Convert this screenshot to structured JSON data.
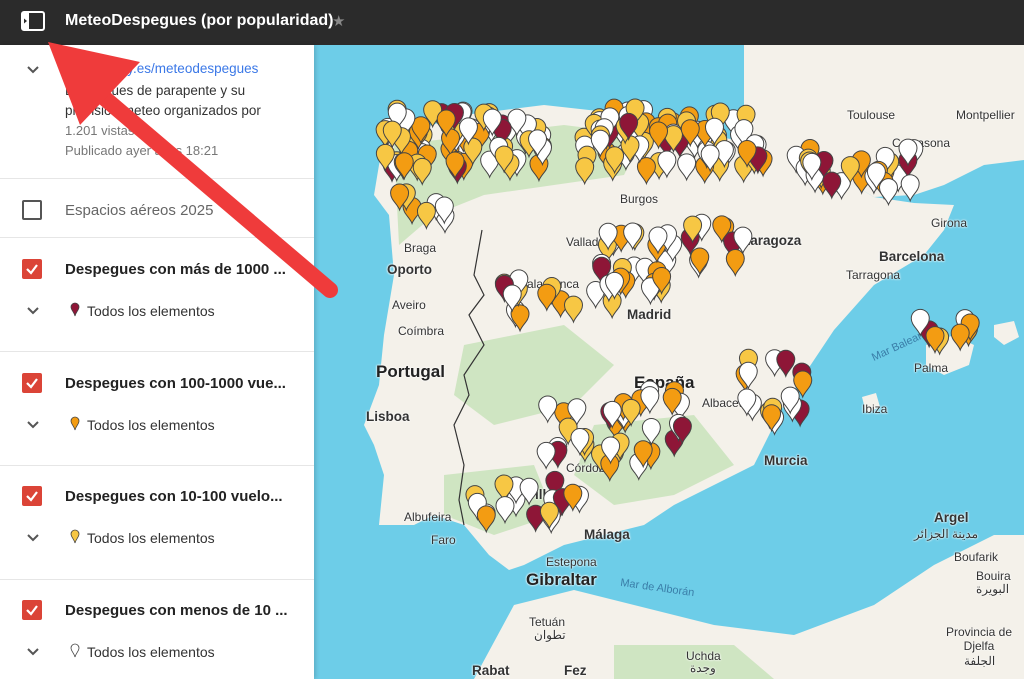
{
  "header": {
    "title": "MeteoDespegues (por popularidad)"
  },
  "meta": {
    "link": "paraglidefly.es/meteodespegues",
    "description": "Despegues de parapente y su previsión meteo organizados por",
    "views": "1.201 vistas",
    "published": "Publicado ayer a las 18:21"
  },
  "layers": [
    {
      "name": "Espacios aéreos 2025",
      "checked": false
    },
    {
      "name": "Despegues con más de 1000 ...",
      "checked": true,
      "sub": "Todos los elementos",
      "pin_color": "#8e1637"
    },
    {
      "name": "Despegues con 100-1000 vue...",
      "checked": true,
      "sub": "Todos los elementos",
      "pin_color": "#f39c12"
    },
    {
      "name": "Despegues con 10-100 vuelo...",
      "checked": true,
      "sub": "Todos los elementos",
      "pin_color": "#f7c744"
    },
    {
      "name": "Despegues con menos de 10 ...",
      "checked": true,
      "sub": "Todos los elementos",
      "pin_color": "#ffffff"
    }
  ],
  "map": {
    "countries": {
      "portugal": "Portugal",
      "espana": "España",
      "gibraltar": "Gibraltar"
    },
    "cities": {
      "toulouse": "Toulouse",
      "montpellier": "Montpellier",
      "carcasona": "Carcasona",
      "burgos": "Burgos",
      "valladolid": "Valladolid",
      "zaragoza": "Zaragoza",
      "braga": "Braga",
      "oporto": "Oporto",
      "aveiro": "Aveiro",
      "coimbra": "Coímbra",
      "salamanca": "Salamanca",
      "madrid": "Madrid",
      "tarragona": "Tarragona",
      "barcelona": "Barcelona",
      "lisboa": "Lisboa",
      "albacete": "Albacete",
      "murcia": "Murcia",
      "cordoba": "Córdoba",
      "sevilla": "Sevilla",
      "albufeira": "Albufeira",
      "faro": "Faro",
      "malaga": "Málaga",
      "estepona": "Estepona",
      "tetuan": "Tetuán",
      "tetuan_ar": "تطوان",
      "rabat": "Rabat",
      "fez": "Fez",
      "uchda": "Uchda",
      "uchda_ar": "وجدة",
      "argel": "Argel",
      "argel_ar": "مدينة الجزائر",
      "boufarik": "Boufarik",
      "bouira": "Bouira",
      "bouira_ar": "البويرة",
      "djelfa": "Provincia de Djelfa",
      "djelfa_ar": "الجلفة",
      "girona": "Girona",
      "palma": "Palma",
      "ibiza": "Ibiza"
    },
    "seas": {
      "mar_balear": "Mar Balear",
      "mar_alboran": "Mar de Alborán"
    },
    "colors": {
      "water": "#6dcde8",
      "land": "#f4f1ea",
      "veg": "#cfe5c2"
    }
  }
}
